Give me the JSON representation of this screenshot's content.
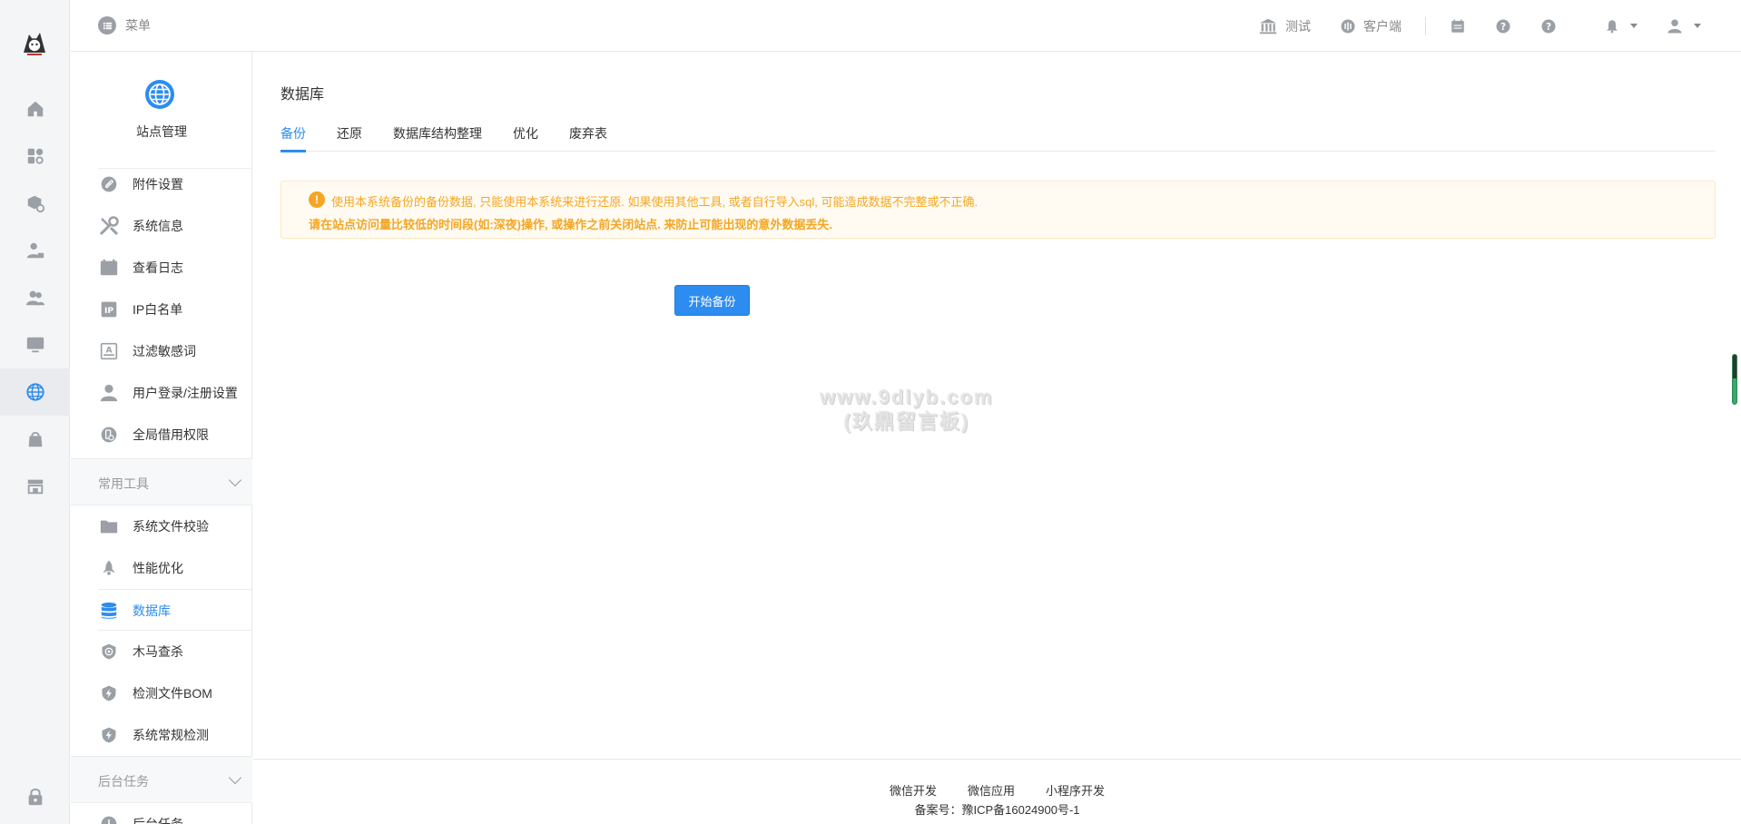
{
  "topbar": {
    "menu_label": "菜单",
    "items": [
      {
        "label": "测试",
        "icon": "bank-icon"
      },
      {
        "label": "客户端",
        "icon": "client-icon"
      }
    ],
    "icons": [
      "calendar-icon",
      "help-icon",
      "help-icon",
      "bell-icon",
      "user-icon"
    ]
  },
  "sidebar": {
    "title": "站点管理",
    "items": [
      {
        "label": "附件设置",
        "icon": "attachment-icon"
      },
      {
        "label": "系统信息",
        "icon": "tools-icon"
      },
      {
        "label": "查看日志",
        "icon": "log-icon"
      },
      {
        "label": "IP白名单",
        "icon": "ip-icon"
      },
      {
        "label": "过滤敏感词",
        "icon": "filter-icon"
      },
      {
        "label": "用户登录/注册设置",
        "icon": "user-settings-icon"
      },
      {
        "label": "全局借用权限",
        "icon": "permission-icon"
      }
    ],
    "group_tools": "常用工具",
    "tools": [
      {
        "label": "系统文件校验",
        "icon": "folder-icon"
      },
      {
        "label": "性能优化",
        "icon": "rocket-icon"
      },
      {
        "label": "数据库",
        "icon": "database-icon"
      },
      {
        "label": "木马查杀",
        "icon": "shield-scan-icon"
      },
      {
        "label": "检测文件BOM",
        "icon": "shield-bolt-icon"
      },
      {
        "label": "系统常规检测",
        "icon": "shield-bolt-icon"
      }
    ],
    "group_tasks": "后台任务",
    "tasks": [
      {
        "label": "后台任务",
        "icon": "task-icon"
      }
    ]
  },
  "main": {
    "title": "数据库",
    "tabs": [
      "备份",
      "还原",
      "数据库结构整理",
      "优化",
      "废弃表"
    ],
    "alert_line1": "使用本系统备份的备份数据, 只能使用本系统来进行还原. 如果使用其他工具, 或者自行导入sql, 可能造成数据不完整或不正确.",
    "alert_line2": "请在站点访问量比较低的时间段(如:深夜)操作, 或操作之前关闭站点. 来防止可能出现的意外数据丢失.",
    "start_button": "开始备份",
    "watermark_line1": "www.9dlyb.com",
    "watermark_line2": "(玖鼎留言板)"
  },
  "footer": {
    "links": [
      "微信开发",
      "微信应用",
      "小程序开发"
    ],
    "icp": "备案号：豫ICP备16024900号-1"
  },
  "colors": {
    "accent": "#2d8cf0",
    "warning": "#f5a623",
    "warning_bg": "#fffbf2"
  }
}
